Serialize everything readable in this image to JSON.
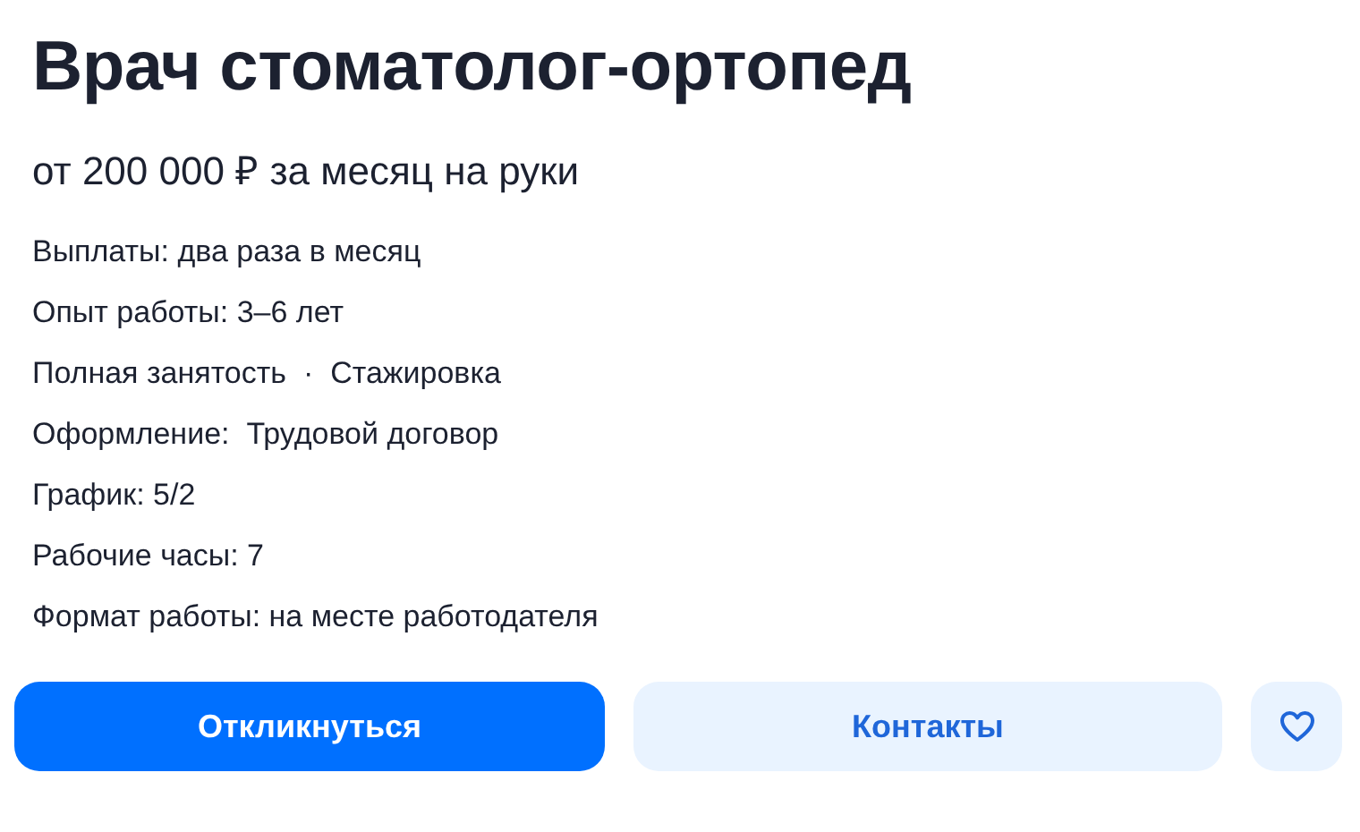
{
  "title": "Врач стоматолог-ортопед",
  "salary": "от 200 000 ₽ за месяц на руки",
  "details": [
    "Выплаты: два раза в месяц",
    "Опыт работы: 3–6 лет",
    "Полная занятость  ·  Стажировка",
    "Оформление:  Трудовой договор",
    "График: 5/2",
    "Рабочие часы: 7",
    "Формат работы: на месте работодателя"
  ],
  "buttons": [
    {
      "kind": "primary",
      "label": "Откликнуться"
    },
    {
      "kind": "secondary",
      "label": "Контакты"
    },
    {
      "kind": "favorite"
    }
  ]
}
